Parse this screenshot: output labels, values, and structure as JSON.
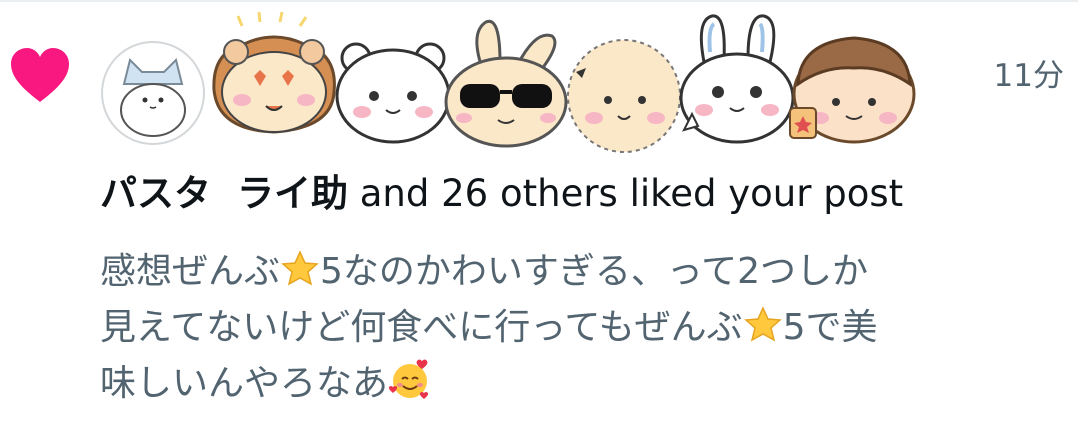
{
  "notification": {
    "type_icon": "heart-icon",
    "time": "11分",
    "likers": {
      "name1": "パスタ",
      "name2": "ライ助",
      "rest": " and 26 others liked your post"
    },
    "avatars": [
      "cat-avatar",
      "lion-avatar",
      "bear-avatar",
      "rabbit-sunglasses-avatar",
      "hedgehog-avatar",
      "rabbit-avatar",
      "kurimanju-avatar"
    ],
    "post_lines": [
      {
        "parts": [
          "感想ぜんぶ",
          "star-emoji",
          "5なのかわいすぎる、って2つしか"
        ]
      },
      {
        "parts": [
          "見えてないけど何食べに行ってもぜんぶ",
          "star-emoji",
          "5で美"
        ]
      },
      {
        "parts": [
          "味しいんやろなあ",
          "smiling-face-with-hearts-emoji"
        ]
      }
    ]
  },
  "colors": {
    "heart": "#F91880",
    "secondary_text": "#536471",
    "primary_text": "#0f1419",
    "star": "#FFC83D"
  }
}
